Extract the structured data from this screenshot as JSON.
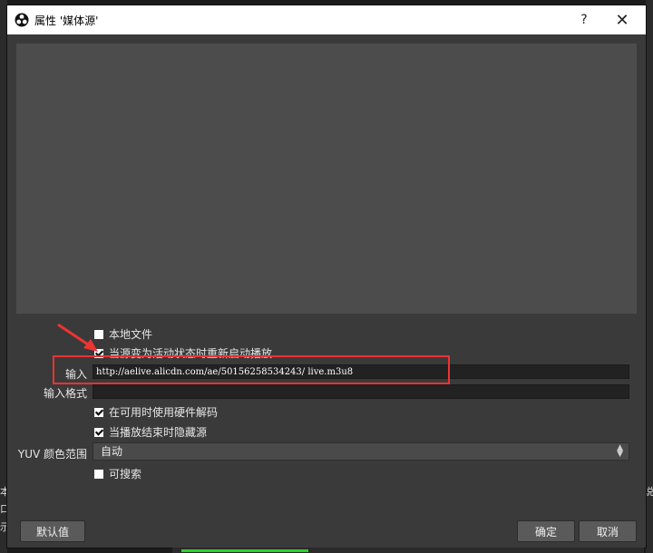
{
  "dialog": {
    "title": "属性 '媒体源'",
    "help_label": "?",
    "close_label": "✕"
  },
  "form": {
    "local_file_label": "本地文件",
    "local_file_checked": false,
    "restart_label": "当源变为活动状态时重新启动播放",
    "restart_checked": true,
    "input_label": "输入",
    "input_value": "http://aelive.alicdn.com/ae/50156258534243/ live.m3u8",
    "input_format_label": "输入格式",
    "input_format_value": "",
    "hw_decode_label": "在可用时使用硬件解码",
    "hw_decode_checked": true,
    "hide_on_end_label": "当播放结束时隐藏源",
    "hide_on_end_checked": true,
    "yuv_label": "YUV 颜色范围",
    "yuv_value": "自动",
    "seekable_label": "可搜索",
    "seekable_checked": false
  },
  "buttons": {
    "defaults_label": "默认值",
    "ok_label": "确定",
    "cancel_label": "取消"
  },
  "background_text": {
    "left_1": "本",
    "left_2": "口",
    "left_3": "示",
    "right_1": "说"
  },
  "colors": {
    "annotation_red": "#e33333",
    "meter_green": "#2bd42b"
  }
}
